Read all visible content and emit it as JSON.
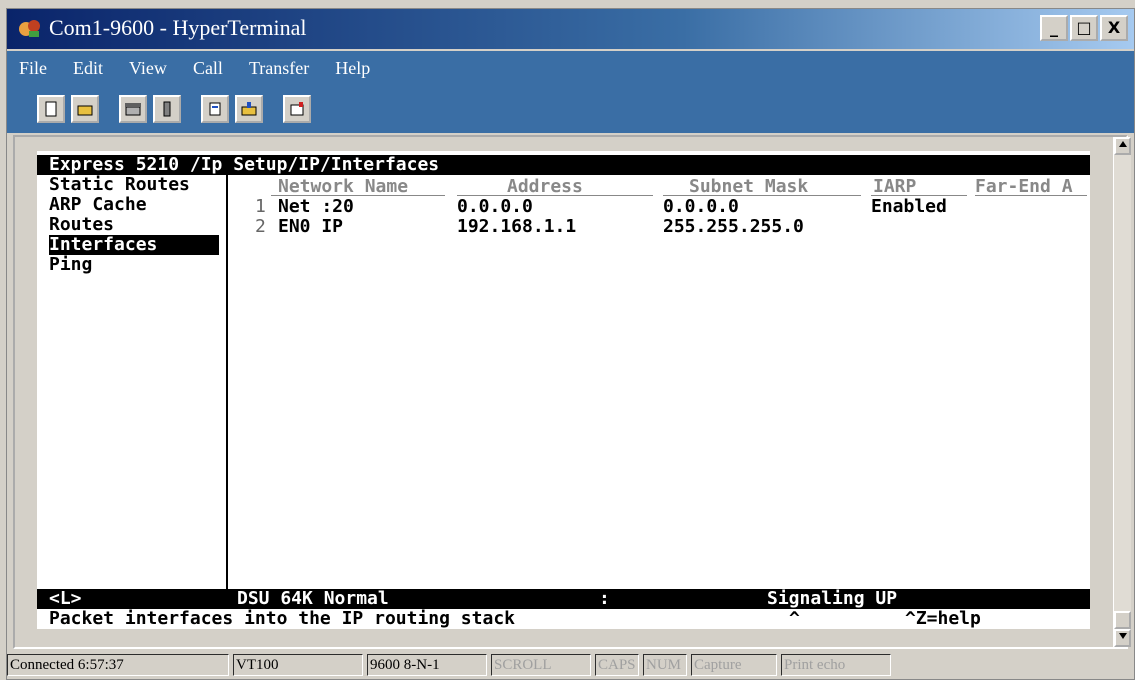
{
  "window": {
    "title": "Com1-9600 - HyperTerminal",
    "buttons": [
      "_",
      "□",
      "X"
    ]
  },
  "menu": [
    "File",
    "Edit",
    "View",
    "Call",
    "Transfer",
    "Help"
  ],
  "toolbar": {
    "icons": [
      "new-connection-icon",
      "open-icon",
      "call-icon",
      "disconnect-icon",
      "send-file-icon",
      "receive-file-icon",
      "properties-icon"
    ]
  },
  "terminal": {
    "title": "Express 5210 /Ip Setup/IP/Interfaces",
    "nav": [
      {
        "label": "Static Routes",
        "selected": false
      },
      {
        "label": "ARP Cache",
        "selected": false
      },
      {
        "label": "Routes",
        "selected": false
      },
      {
        "label": "Interfaces",
        "selected": true
      },
      {
        "label": "Ping",
        "selected": false
      }
    ],
    "table": {
      "headers": [
        "Network Name",
        "Address",
        "Subnet Mask",
        "IARP",
        "Far-End A"
      ],
      "rows": [
        {
          "num": "1",
          "name": "Net :20",
          "address": "0.0.0.0",
          "mask": "0.0.0.0",
          "iarp": "Enabled"
        },
        {
          "num": "2",
          "name": "EN0 IP",
          "address": "192.168.1.1",
          "mask": "255.255.255.0",
          "iarp": ""
        }
      ]
    },
    "status": {
      "left": "<L>",
      "mode": "DSU 64K Normal",
      "sep": ":",
      "signal": "Signaling UP"
    },
    "help": {
      "text": "Packet interfaces into the IP routing stack",
      "caret": "^",
      "hint": "^Z=help"
    }
  },
  "statusbar": {
    "connected": "Connected 6:57:37",
    "emulation": "VT100",
    "settings": "9600 8-N-1",
    "scroll": "SCROLL",
    "caps": "CAPS",
    "num": "NUM",
    "capture": "Capture",
    "print_echo": "Print echo"
  },
  "colors": {
    "titlebar": "#0a246a",
    "menubar": "#3a6ea5",
    "chrome": "#d4d0c8"
  }
}
